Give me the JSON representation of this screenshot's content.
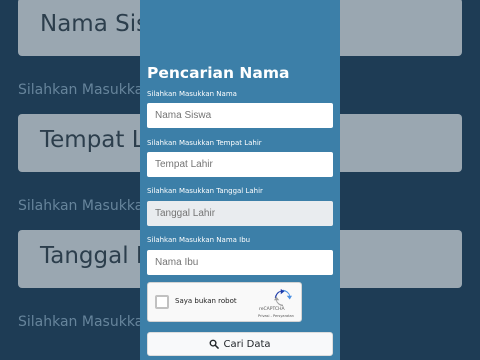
{
  "background": {
    "fields": [
      "Nama Siswa",
      "Tempat Lahir",
      "Tanggal Lahir"
    ],
    "labels": [
      "Silahkan Masukkan Nama",
      "Silahkan Masukkan Tempat Lahir",
      "Silahkan Masukkan Tanggal Lahir",
      "Silahkan Masukkan Nama Ibu"
    ]
  },
  "form": {
    "title": "Pencarian Nama",
    "fields": [
      {
        "label": "Silahkan Masukkan Nama",
        "placeholder": "Nama Siswa"
      },
      {
        "label": "Silahkan Masukkan Tempat Lahir",
        "placeholder": "Tempat Lahir"
      },
      {
        "label": "Silahkan Masukkan Tanggal Lahir",
        "placeholder": "Tanggal Lahir"
      },
      {
        "label": "Silahkan Masukkan Nama Ibu",
        "placeholder": "Nama Ibu"
      }
    ],
    "captcha": {
      "text": "Saya bukan robot",
      "brand": "reCAPTCHA",
      "links": "Privasi - Persyaratan"
    },
    "submit_label": "Cari Data"
  },
  "colors": {
    "card": "#3c7fa8",
    "background": "#1e3c55"
  }
}
